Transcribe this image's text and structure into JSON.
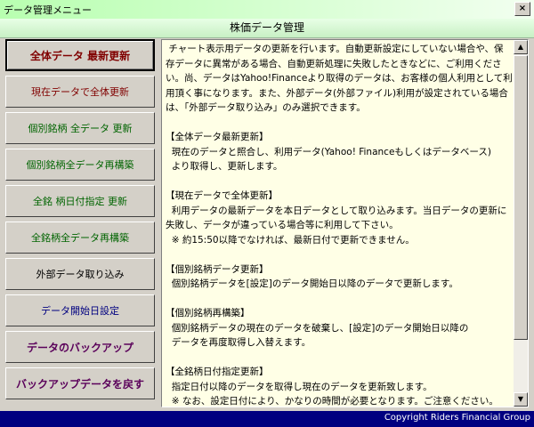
{
  "window": {
    "title": "データ管理メニュー",
    "close_label": "×"
  },
  "header": {
    "title": "株価データ管理"
  },
  "buttons": [
    {
      "label": "全体データ 最新更新",
      "color": "#800000"
    },
    {
      "label": "現在データで全体更新",
      "color": "#800000"
    },
    {
      "label": "個別銘柄 全データ 更新",
      "color": "#006400"
    },
    {
      "label": "個別銘柄全データ再構築",
      "color": "#006400"
    },
    {
      "label": "全銘 柄日付指定 更新",
      "color": "#006400"
    },
    {
      "label": "全銘柄全データ再構築",
      "color": "#006400"
    },
    {
      "label": "外部データ取り込み",
      "color": "#000000"
    },
    {
      "label": "データ開始日設定",
      "color": "#000080"
    },
    {
      "label": "データのバックアップ",
      "color": "#5a005a"
    },
    {
      "label": "バックアップデータを戻す",
      "color": "#5a005a"
    }
  ],
  "description": " チャート表示用データの更新を行います。自動更新設定にしていない場合や、保存データに異常がある場合、自動更新処理に失敗したときなどに、ご利用ください。尚、データはYahoo!Financeより取得のデータは、お客様の個人利用として利用頂く事になります。また、外部データ(外部ファイル)利用が設定されている場合は、「外部データ取り込み」のみ選択できます。\n\n【全体データ最新更新】\n  現在のデータと照合し、利用データ(Yahoo! Financeもしくはデータベース)\n  より取得し、更新します。\n\n【現在データで全体更新】\n  利用データの最新データを本日データとして取り込みます。当日データの更新に失敗し、データが違っている場合等に利用して下さい。\n  ※ 約15:50以降でなければ、最新日付で更新できません。\n\n【個別銘柄データ更新】\n  個別銘柄データを[設定]のデータ開始日以降のデータで更新します。\n\n【個別銘柄再構築】\n  個別銘柄データの現在のデータを破棄し、[設定]のデータ開始日以降の\n  データを再度取得し入替えます。\n\n【全銘柄日付指定更新】\n  指定日付以降のデータを取得し現在のデータを更新致します。\n  ※ なお、設定日付により、かなりの時間が必要となります。ご注意ください。\n  ※ 指定日付が、[設定]のデータ開始日より古い場合は、データ開始日の設定",
  "scrollbar": {
    "up": "▲",
    "down": "▼"
  },
  "footer": {
    "copyright": "Copyright Riders Financial Group"
  }
}
